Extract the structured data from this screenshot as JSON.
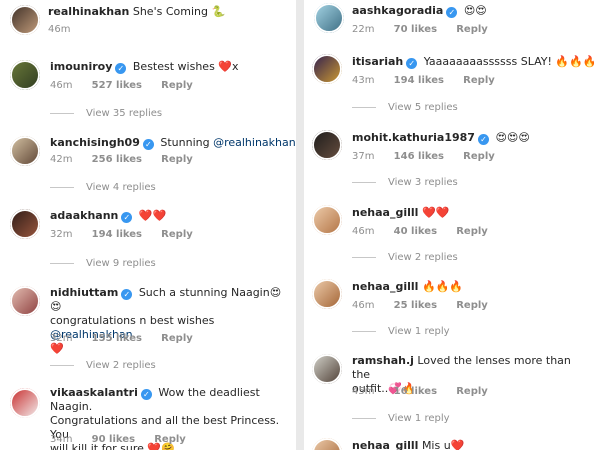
{
  "left": {
    "comments": [
      {
        "username": "realhinakhan",
        "verified": false,
        "text": "She's Coming 🐍",
        "time": "46m",
        "likes": "",
        "reply": "",
        "replies": ""
      },
      {
        "username": "imouniroy",
        "verified": true,
        "text": "Bestest wishes ❤️x",
        "time": "46m",
        "likes": "527 likes",
        "reply": "Reply",
        "replies": "View 35 replies"
      },
      {
        "username": "kanchisingh09",
        "verified": true,
        "text": "Stunning ",
        "mention": "@realhinakhan",
        "time": "42m",
        "likes": "256 likes",
        "reply": "Reply",
        "replies": "View 4 replies"
      },
      {
        "username": "adaakhann",
        "verified": true,
        "text": "❤️❤️",
        "time": "32m",
        "likes": "194 likes",
        "reply": "Reply",
        "replies": "View 9 replies"
      },
      {
        "username": "nidhiuttam",
        "verified": true,
        "text": "Such a stunning Naagin😍😍",
        "text2": "congratulations n best wishes ",
        "mention2": "@realhinakhan",
        "text3": "❤️",
        "time": "32m",
        "likes": "155 likes",
        "reply": "Reply",
        "replies": "View 2 replies"
      },
      {
        "username": "vikaaskalantri",
        "verified": true,
        "text": "Wow the deadliest Naagin.",
        "text2": "Congratulations and all the best Princess. You",
        "text3": "will kill it for sure ❤️🤗",
        "time": "34m",
        "likes": "90 likes",
        "reply": "Reply",
        "replies": ""
      }
    ]
  },
  "right": {
    "comments": [
      {
        "username": "aashkagoradia",
        "verified": true,
        "text": "😍😍",
        "time": "22m",
        "likes": "70 likes",
        "reply": "Reply",
        "replies": ""
      },
      {
        "username": "itisariah",
        "verified": true,
        "text": "Yaaaaaaaassssss SLAY! 🔥🔥🔥",
        "time": "43m",
        "likes": "194 likes",
        "reply": "Reply",
        "replies": "View 5 replies"
      },
      {
        "username": "mohit.kathuria1987",
        "verified": true,
        "text": "😍😍😍",
        "time": "37m",
        "likes": "146 likes",
        "reply": "Reply",
        "replies": "View 3 replies"
      },
      {
        "username": "nehaa_gilll",
        "verified": false,
        "text": "❤️❤️",
        "time": "46m",
        "likes": "40 likes",
        "reply": "Reply",
        "replies": "View 2 replies"
      },
      {
        "username": "nehaa_gilll",
        "verified": false,
        "text": "🔥🔥🔥",
        "time": "46m",
        "likes": "25 likes",
        "reply": "Reply",
        "replies": "View 1 reply"
      },
      {
        "username": "ramshah.j",
        "verified": false,
        "text": "Loved the lenses more than the",
        "text2": "outfit..💞🔥",
        "time": "45m",
        "likes": "16 likes",
        "reply": "Reply",
        "replies": "View 1 reply"
      },
      {
        "username": "nehaa_gilll",
        "verified": false,
        "text": "Mis u❤️",
        "time": "",
        "likes": "",
        "reply": "",
        "replies": ""
      }
    ]
  },
  "colors": {
    "verified": "#3897f0",
    "mention": "#00376b",
    "meta": "#8e8e8e"
  }
}
